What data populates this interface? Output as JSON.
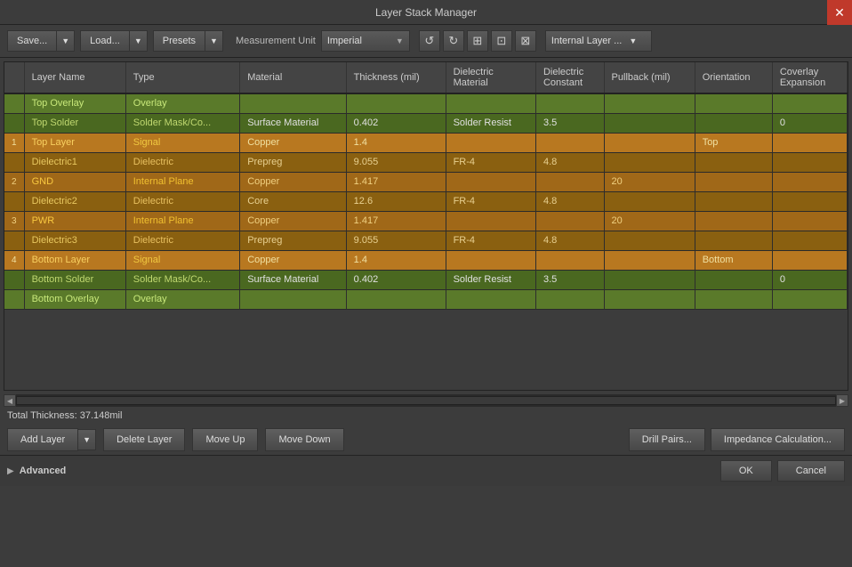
{
  "titleBar": {
    "title": "Layer Stack Manager",
    "closeIcon": "✕"
  },
  "toolbar": {
    "saveLabel": "Save...",
    "loadLabel": "Load...",
    "presetsLabel": "Presets",
    "measurementUnitLabel": "Measurement Unit",
    "measurementUnitValue": "Imperial",
    "undoIcon": "↺",
    "redoIcon": "↻",
    "icon1": "⊞",
    "icon2": "⊟",
    "icon3": "⊠",
    "internalLayerLabel": "Internal Layer ...",
    "dropdownArrow": "▼"
  },
  "table": {
    "headers": [
      "",
      "Layer Name",
      "Type",
      "Material",
      "Thickness (mil)",
      "Dielectric\nMaterial",
      "Dielectric\nConstant",
      "Pullback (mil)",
      "Orientation",
      "Coverlay\nExpansion"
    ],
    "rows": [
      {
        "num": "",
        "name": "Top Overlay",
        "type": "Overlay",
        "material": "",
        "thickness": "",
        "dielectricMaterial": "",
        "dielectricConstant": "",
        "pullback": "",
        "orientation": "",
        "coverlayExpansion": "",
        "rowClass": "row-overlay-top"
      },
      {
        "num": "",
        "name": "Top Solder",
        "type": "Solder Mask/Co...",
        "material": "Surface Material",
        "thickness": "0.402",
        "dielectricMaterial": "Solder Resist",
        "dielectricConstant": "3.5",
        "pullback": "",
        "orientation": "",
        "coverlayExpansion": "0",
        "rowClass": "row-solder-top"
      },
      {
        "num": "1",
        "name": "Top Layer",
        "type": "Signal",
        "material": "Copper",
        "thickness": "1.4",
        "dielectricMaterial": "",
        "dielectricConstant": "",
        "pullback": "",
        "orientation": "Top",
        "coverlayExpansion": "",
        "rowClass": "row-signal"
      },
      {
        "num": "",
        "name": "Dielectric1",
        "type": "Dielectric",
        "material": "Prepreg",
        "thickness": "9.055",
        "dielectricMaterial": "FR-4",
        "dielectricConstant": "4.8",
        "pullback": "",
        "orientation": "",
        "coverlayExpansion": "",
        "rowClass": "row-dielectric"
      },
      {
        "num": "2",
        "name": "GND",
        "type": "Internal Plane",
        "material": "Copper",
        "thickness": "1.417",
        "dielectricMaterial": "",
        "dielectricConstant": "",
        "pullback": "20",
        "orientation": "",
        "coverlayExpansion": "",
        "rowClass": "row-internal-plane"
      },
      {
        "num": "",
        "name": "Dielectric2",
        "type": "Dielectric",
        "material": "Core",
        "thickness": "12.6",
        "dielectricMaterial": "FR-4",
        "dielectricConstant": "4.8",
        "pullback": "",
        "orientation": "",
        "coverlayExpansion": "",
        "rowClass": "row-dielectric"
      },
      {
        "num": "3",
        "name": "PWR",
        "type": "Internal Plane",
        "material": "Copper",
        "thickness": "1.417",
        "dielectricMaterial": "",
        "dielectricConstant": "",
        "pullback": "20",
        "orientation": "",
        "coverlayExpansion": "",
        "rowClass": "row-internal-plane"
      },
      {
        "num": "",
        "name": "Dielectric3",
        "type": "Dielectric",
        "material": "Prepreg",
        "thickness": "9.055",
        "dielectricMaterial": "FR-4",
        "dielectricConstant": "4.8",
        "pullback": "",
        "orientation": "",
        "coverlayExpansion": "",
        "rowClass": "row-dielectric"
      },
      {
        "num": "4",
        "name": "Bottom Layer",
        "type": "Signal",
        "material": "Copper",
        "thickness": "1.4",
        "dielectricMaterial": "",
        "dielectricConstant": "",
        "pullback": "",
        "orientation": "Bottom",
        "coverlayExpansion": "",
        "rowClass": "row-signal"
      },
      {
        "num": "",
        "name": "Bottom Solder",
        "type": "Solder Mask/Co...",
        "material": "Surface Material",
        "thickness": "0.402",
        "dielectricMaterial": "Solder Resist",
        "dielectricConstant": "3.5",
        "pullback": "",
        "orientation": "",
        "coverlayExpansion": "0",
        "rowClass": "row-solder-bottom"
      },
      {
        "num": "",
        "name": "Bottom Overlay",
        "type": "Overlay",
        "material": "",
        "thickness": "",
        "dielectricMaterial": "",
        "dielectricConstant": "",
        "pullback": "",
        "orientation": "",
        "coverlayExpansion": "",
        "rowClass": "row-overlay-bottom"
      }
    ]
  },
  "bottomSection": {
    "totalThickness": "Total Thickness: 37.148mil",
    "addLayerLabel": "Add Layer",
    "deleteLayerLabel": "Delete Layer",
    "moveUpLabel": "Move Up",
    "moveDownLabel": "Move Down",
    "drillPairsLabel": "Drill Pairs...",
    "impedanceCalculationLabel": "Impedance Calculation..."
  },
  "advancedBar": {
    "label": "Advanced",
    "arrow": "▶"
  },
  "dialogButtons": {
    "ok": "OK",
    "cancel": "Cancel"
  }
}
